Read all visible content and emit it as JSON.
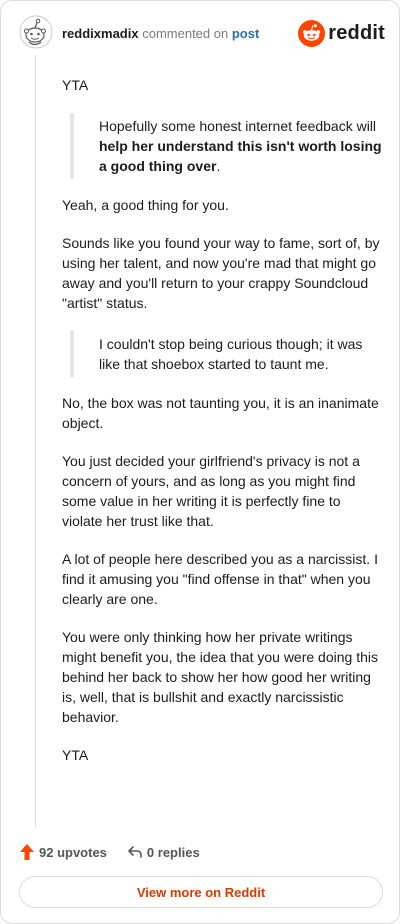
{
  "header": {
    "username": "reddixmadix",
    "action": "commented on",
    "post_link": "post",
    "logo_text": "reddit"
  },
  "comment": {
    "p1": "YTA",
    "quote1": {
      "before": "Hopefully some honest internet feedback will ",
      "bold": "help her understand this isn't worth losing a good thing over",
      "after": "."
    },
    "p2": "Yeah, a good thing for you.",
    "p3": "Sounds like you found your way to fame, sort of, by using her talent, and now you're mad that might go away and you'll return to your crappy Soundcloud \"artist\" status.",
    "quote2": "I couldn't stop being curious though; it was like that shoebox started to taunt me.",
    "p4": "No, the box was not taunting you, it is an inanimate object.",
    "p5": "You just decided your girlfriend's privacy is not a concern of yours, and as long as you might find some value in her writing it is perfectly fine to violate her trust like that.",
    "p6": "A lot of people here described you as a narcissist. I find it amusing you \"find offense in that\" when you clearly are one.",
    "p7": "You were only thinking how her private writings might benefit you, the idea that you were doing this behind her back to show her how good her writing is, well, that is bullshit and exactly narcissistic behavior.",
    "p8": "YTA"
  },
  "footer": {
    "upvotes": "92 upvotes",
    "replies": "0 replies",
    "view_more": "View more on Reddit"
  },
  "colors": {
    "brand": "#ff4500",
    "link": "#2b6cb0",
    "view_more": "#d93a00"
  },
  "icons": [
    "avatar-snoo",
    "reddit-logo-icon",
    "upvote-arrow-icon",
    "reply-arrow-icon"
  ]
}
